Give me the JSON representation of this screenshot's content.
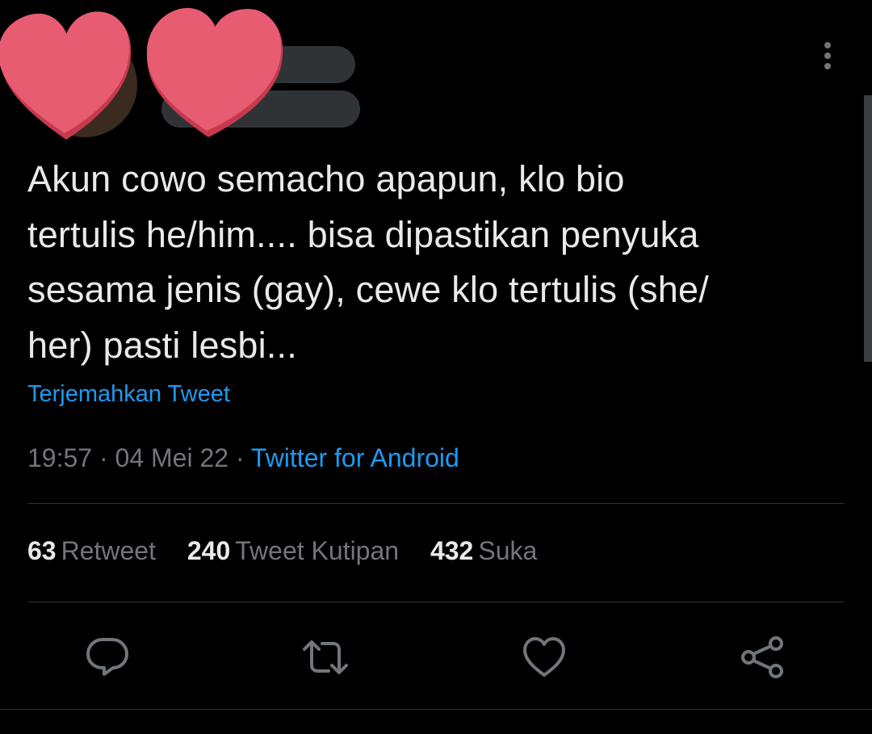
{
  "tweet": {
    "text_lines": [
      "Akun cowo semacho apapun, klo bio",
      "tertulis he/him.... bisa dipastikan penyuka",
      "sesama jenis (gay), cewe klo tertulis (she/",
      "her) pasti lesbi..."
    ],
    "translate_label": "Terjemahkan Tweet",
    "time": "19:57",
    "separator": "·",
    "date": "04 Mei 22",
    "source": "Twitter for Android"
  },
  "stats": {
    "retweets": {
      "count": "63",
      "label": "Retweet"
    },
    "quotes": {
      "count": "240",
      "label": "Tweet Kutipan"
    },
    "likes": {
      "count": "432",
      "label": "Suka"
    }
  },
  "icons": {
    "more": "more-vertical-icon",
    "reply": "reply-icon",
    "retweet": "retweet-icon",
    "like": "heart-icon",
    "share": "share-icon",
    "redaction": "heart-sticker"
  },
  "colors": {
    "background": "#000000",
    "text": "#e7e9ea",
    "muted": "#71767b",
    "link": "#1d9bf0",
    "redaction": "#e85c71"
  }
}
